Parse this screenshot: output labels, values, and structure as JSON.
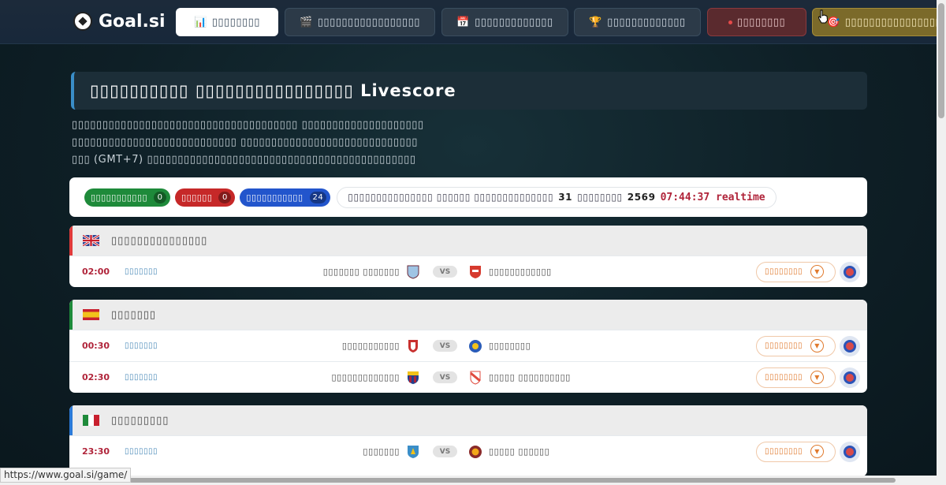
{
  "app": {
    "logo_text": "Goal.si",
    "logo_icon": "soccer-ball-icon"
  },
  "nav": [
    {
      "label": "▯▯▯▯▯▯▯▯",
      "icon": "📊",
      "icon_name": "chart-icon",
      "style": "active"
    },
    {
      "label": "▯▯▯▯▯▯▯▯▯▯▯▯▯▯▯▯▯",
      "icon": "🎬",
      "icon_name": "clapper-icon",
      "style": "normal"
    },
    {
      "label": "▯▯▯▯▯▯▯▯▯▯▯▯▯",
      "icon": "📅",
      "icon_name": "calendar-icon",
      "style": "normal"
    },
    {
      "label": "▯▯▯▯▯▯▯▯▯▯▯▯▯",
      "icon": "🏆",
      "icon_name": "trophy-icon",
      "style": "normal"
    },
    {
      "label": "▯▯▯▯▯▯▯▯",
      "icon": "",
      "icon_name": "live-dot-icon",
      "style": "live"
    },
    {
      "label": "▯▯▯▯▯▯▯▯▯▯▯▯▯▯▯▯▯▯",
      "icon": "🎯",
      "icon_name": "target-icon",
      "style": "odds"
    }
  ],
  "page": {
    "title": "▯▯▯▯▯▯▯▯▯▯ ▯▯▯▯▯▯▯▯▯▯▯▯▯▯▯▯ Livescore",
    "intro_lines": [
      "▯▯▯▯▯▯▯▯▯▯▯▯▯▯▯▯▯▯▯▯▯▯▯▯▯▯▯▯▯▯▯▯▯▯▯▯▯ ▯▯▯▯▯▯▯▯▯▯▯▯▯▯▯▯▯▯▯▯",
      "▯▯▯▯▯▯▯▯▯▯▯▯▯▯▯▯▯▯▯▯▯▯▯▯▯▯▯ ▯▯▯▯▯▯▯▯▯▯▯▯▯▯▯▯▯▯▯▯▯▯▯▯▯▯▯▯▯",
      "▯▯▯ (GMT+7) ▯▯▯▯▯▯▯▯▯▯▯▯▯▯▯▯▯▯▯▯▯▯▯▯▯▯▯▯▯▯▯▯▯▯▯▯▯▯▯▯▯▯▯▯"
    ]
  },
  "status": {
    "pills": [
      {
        "label": "▯▯▯▯▯▯▯▯▯▯▯",
        "count": "0",
        "color": "#1e8a3a"
      },
      {
        "label": "▯▯▯▯▯▯",
        "count": "0",
        "color": "#c62828"
      },
      {
        "label": "▯▯▯▯▯▯▯▯▯▯▯",
        "count": "24",
        "color": "#2255cc"
      }
    ],
    "summary_text_1": "▯▯▯▯▯▯▯▯▯▯▯▯▯▯▯ ▯▯▯▯▯▯ ▯▯▯▯▯▯▯▯▯▯▯▯▯▯",
    "summary_num_1": "31",
    "summary_text_2": "▯▯▯▯▯▯▯▯",
    "summary_num_2": "2569",
    "clock": "07:44:37 realtime"
  },
  "leagues": [
    {
      "name": "▯▯▯▯▯▯▯▯▯▯▯▯▯▯▯",
      "flag": "uk-flag-icon",
      "accent": "#e03a3a",
      "matches": [
        {
          "time": "02:00",
          "status": "▯▯▯▯▯▯▯",
          "home": "▯▯▯▯▯▯▯ ▯▯▯▯▯▯▯",
          "away": "▯▯▯▯▯▯▯▯▯▯▯▯",
          "home_crest": "#8ab4d8",
          "away_crest": "#d63a2e",
          "detail": "▯▯▯▯▯▯▯▯"
        }
      ]
    },
    {
      "name": "▯▯▯▯▯▯▯",
      "flag": "spain-flag-icon",
      "accent": "#1e8a3a",
      "matches": [
        {
          "time": "00:30",
          "status": "▯▯▯▯▯▯▯",
          "home": "▯▯▯▯▯▯▯▯▯▯▯",
          "away": "▯▯▯▯▯▯▯▯",
          "home_crest": "#c8302e",
          "away_crest": "#2a5cb8",
          "detail": "▯▯▯▯▯▯▯▯"
        },
        {
          "time": "02:30",
          "status": "▯▯▯▯▯▯▯",
          "home": "▯▯▯▯▯▯▯▯▯▯▯▯▯",
          "away": "▯▯▯▯▯ ▯▯▯▯▯▯▯▯▯▯",
          "home_crest": "#a8243a",
          "away_crest": "#e04a3e",
          "detail": "▯▯▯▯▯▯▯▯"
        }
      ]
    },
    {
      "name": "▯▯▯▯▯▯▯▯▯",
      "flag": "italy-flag-icon",
      "accent": "#2b7ad8",
      "matches": [
        {
          "time": "23:30",
          "status": "▯▯▯▯▯▯▯",
          "home": "▯▯▯▯▯▯▯",
          "away": "▯▯▯▯▯ ▯▯▯▯▯▯",
          "home_crest": "#3a8ec8",
          "away_crest": "#c8643a",
          "detail": "▯▯▯▯▯▯▯▯"
        }
      ]
    }
  ],
  "hover_url": "https://www.goal.si/game/"
}
